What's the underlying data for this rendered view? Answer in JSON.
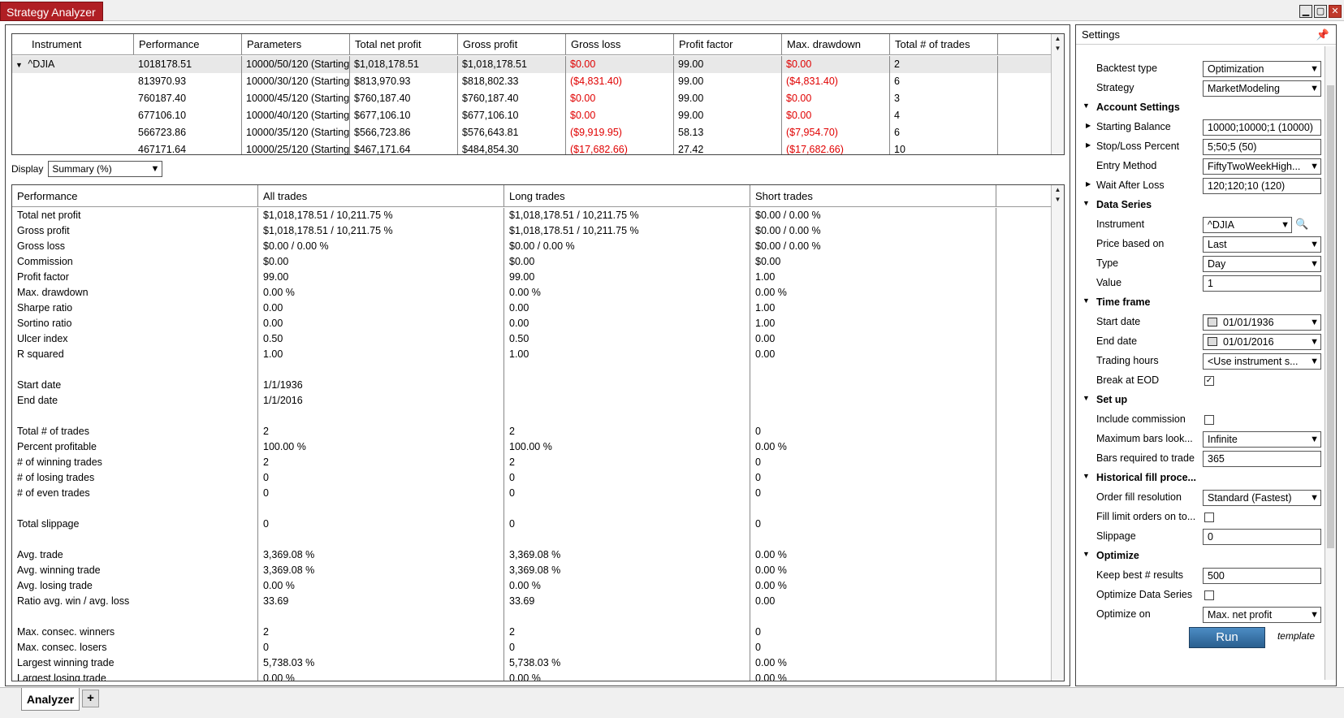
{
  "window": {
    "title": "Strategy Analyzer"
  },
  "results": {
    "columns": [
      "Instrument",
      "Performance",
      "Parameters",
      "Total net profit",
      "Gross profit",
      "Gross loss",
      "Profit factor",
      "Max. drawdown",
      "Total # of trades"
    ],
    "rows": [
      {
        "instrument": "^DJIA",
        "performance": "1018178.51",
        "parameters": "10000/50/120 (Starting",
        "net": "$1,018,178.51",
        "gross_profit": "$1,018,178.51",
        "gross_loss": "$0.00",
        "pf": "99.00",
        "dd": "$0.00",
        "trades": "2"
      },
      {
        "instrument": "",
        "performance": "813970.93",
        "parameters": "10000/30/120 (Starting",
        "net": "$813,970.93",
        "gross_profit": "$818,802.33",
        "gross_loss": "($4,831.40)",
        "pf": "99.00",
        "dd": "($4,831.40)",
        "trades": "6"
      },
      {
        "instrument": "",
        "performance": "760187.40",
        "parameters": "10000/45/120 (Starting",
        "net": "$760,187.40",
        "gross_profit": "$760,187.40",
        "gross_loss": "$0.00",
        "pf": "99.00",
        "dd": "$0.00",
        "trades": "3"
      },
      {
        "instrument": "",
        "performance": "677106.10",
        "parameters": "10000/40/120 (Starting",
        "net": "$677,106.10",
        "gross_profit": "$677,106.10",
        "gross_loss": "$0.00",
        "pf": "99.00",
        "dd": "$0.00",
        "trades": "4"
      },
      {
        "instrument": "",
        "performance": "566723.86",
        "parameters": "10000/35/120 (Starting",
        "net": "$566,723.86",
        "gross_profit": "$576,643.81",
        "gross_loss": "($9,919.95)",
        "pf": "58.13",
        "dd": "($7,954.70)",
        "trades": "6"
      },
      {
        "instrument": "",
        "performance": "467171.64",
        "parameters": "10000/25/120 (Starting",
        "net": "$467,171.64",
        "gross_profit": "$484,854.30",
        "gross_loss": "($17,682.66)",
        "pf": "27.42",
        "dd": "($17,682.66)",
        "trades": "10"
      }
    ]
  },
  "display": {
    "label": "Display",
    "value": "Summary (%)"
  },
  "summary": {
    "columns": [
      "Performance",
      "All trades",
      "Long trades",
      "Short trades"
    ],
    "rows": [
      [
        "Total net profit",
        "$1,018,178.51 / 10,211.75 %",
        "$1,018,178.51 / 10,211.75 %",
        "$0.00 / 0.00 %"
      ],
      [
        "Gross profit",
        "$1,018,178.51 / 10,211.75 %",
        "$1,018,178.51 / 10,211.75 %",
        "$0.00 / 0.00 %"
      ],
      [
        "Gross loss",
        "$0.00 / 0.00 %",
        "$0.00 / 0.00 %",
        "$0.00 / 0.00 %"
      ],
      [
        "Commission",
        "$0.00",
        "$0.00",
        "$0.00"
      ],
      [
        "Profit factor",
        "99.00",
        "99.00",
        "1.00"
      ],
      [
        "Max. drawdown",
        "0.00 %",
        "0.00 %",
        "0.00 %"
      ],
      [
        "Sharpe ratio",
        "0.00",
        "0.00",
        "1.00"
      ],
      [
        "Sortino ratio",
        "0.00",
        "0.00",
        "1.00"
      ],
      [
        "Ulcer index",
        "0.50",
        "0.50",
        "0.00"
      ],
      [
        "R squared",
        "1.00",
        "1.00",
        "0.00"
      ],
      [
        "",
        "",
        "",
        ""
      ],
      [
        "Start date",
        "1/1/1936",
        "",
        ""
      ],
      [
        "End date",
        "1/1/2016",
        "",
        ""
      ],
      [
        "",
        "",
        "",
        ""
      ],
      [
        "Total # of trades",
        "2",
        "2",
        "0"
      ],
      [
        "Percent profitable",
        "100.00 %",
        "100.00 %",
        "0.00 %"
      ],
      [
        "# of winning trades",
        "2",
        "2",
        "0"
      ],
      [
        "# of losing trades",
        "0",
        "0",
        "0"
      ],
      [
        "# of even trades",
        "0",
        "0",
        "0"
      ],
      [
        "",
        "",
        "",
        ""
      ],
      [
        "Total slippage",
        "0",
        "0",
        "0"
      ],
      [
        "",
        "",
        "",
        ""
      ],
      [
        "Avg. trade",
        "3,369.08 %",
        "3,369.08 %",
        "0.00 %"
      ],
      [
        "Avg. winning trade",
        "3,369.08 %",
        "3,369.08 %",
        "0.00 %"
      ],
      [
        "Avg. losing trade",
        "0.00 %",
        "0.00 %",
        "0.00 %"
      ],
      [
        "Ratio avg. win / avg. loss",
        "33.69",
        "33.69",
        "0.00"
      ],
      [
        "",
        "",
        "",
        ""
      ],
      [
        "Max. consec. winners",
        "2",
        "2",
        "0"
      ],
      [
        "Max. consec. losers",
        "0",
        "0",
        "0"
      ],
      [
        "Largest winning trade",
        "5,738.03 %",
        "5,738.03 %",
        "0.00 %"
      ],
      [
        "Largest losing trade",
        "0.00 %",
        "0.00 %",
        "0.00 %"
      ]
    ]
  },
  "settings": {
    "title": "Settings",
    "items": [
      {
        "kind": "prop",
        "label": "Backtest type",
        "value": "Optimization",
        "control": "select"
      },
      {
        "kind": "prop",
        "label": "Strategy",
        "value": "MarketModeling",
        "control": "select"
      },
      {
        "kind": "cat",
        "label": "Account Settings"
      },
      {
        "kind": "prop",
        "label": "Starting Balance",
        "value": "10000;10000;1 (10000)",
        "control": "text",
        "expand": true
      },
      {
        "kind": "prop",
        "label": "Stop/Loss Percent",
        "value": "5;50;5 (50)",
        "control": "text",
        "expand": true
      },
      {
        "kind": "prop",
        "label": "Entry Method",
        "value": "FiftyTwoWeekHigh...",
        "control": "select"
      },
      {
        "kind": "prop",
        "label": "Wait After Loss",
        "value": "120;120;10 (120)",
        "control": "text",
        "expand": true
      },
      {
        "kind": "cat",
        "label": "Data Series"
      },
      {
        "kind": "prop",
        "label": "Instrument",
        "value": "^DJIA",
        "control": "instrument"
      },
      {
        "kind": "prop",
        "label": "Price based on",
        "value": "Last",
        "control": "select"
      },
      {
        "kind": "prop",
        "label": "Type",
        "value": "Day",
        "control": "select"
      },
      {
        "kind": "prop",
        "label": "Value",
        "value": "1",
        "control": "text"
      },
      {
        "kind": "cat",
        "label": "Time frame"
      },
      {
        "kind": "prop",
        "label": "Start date",
        "value": "01/01/1936",
        "control": "date"
      },
      {
        "kind": "prop",
        "label": "End date",
        "value": "01/01/2016",
        "control": "date"
      },
      {
        "kind": "prop",
        "label": "Trading hours",
        "value": "<Use instrument s...",
        "control": "select"
      },
      {
        "kind": "prop",
        "label": "Break at EOD",
        "value": "checked",
        "control": "check"
      },
      {
        "kind": "cat",
        "label": "Set up"
      },
      {
        "kind": "prop",
        "label": "Include commission",
        "value": "",
        "control": "check"
      },
      {
        "kind": "prop",
        "label": "Maximum bars look...",
        "value": "Infinite",
        "control": "select"
      },
      {
        "kind": "prop",
        "label": "Bars required to trade",
        "value": "365",
        "control": "text"
      },
      {
        "kind": "cat",
        "label": "Historical fill proce..."
      },
      {
        "kind": "prop",
        "label": "Order fill resolution",
        "value": "Standard (Fastest)",
        "control": "select"
      },
      {
        "kind": "prop",
        "label": "Fill limit orders on to...",
        "value": "",
        "control": "check"
      },
      {
        "kind": "prop",
        "label": "Slippage",
        "value": "0",
        "control": "text"
      },
      {
        "kind": "cat",
        "label": "Optimize"
      },
      {
        "kind": "prop",
        "label": "Keep best # results",
        "value": "500",
        "control": "text"
      },
      {
        "kind": "prop",
        "label": "Optimize Data Series",
        "value": "",
        "control": "check"
      },
      {
        "kind": "prop",
        "label": "Optimize on",
        "value": "Max. net profit",
        "control": "select"
      }
    ],
    "template_label": "template",
    "run_label": "Run"
  },
  "tabs": {
    "active": "Analyzer",
    "add": "+"
  },
  "colors": {
    "title_bg": "#b01f24",
    "negative": "#e00000",
    "run_bg": "#2a5f8f"
  }
}
